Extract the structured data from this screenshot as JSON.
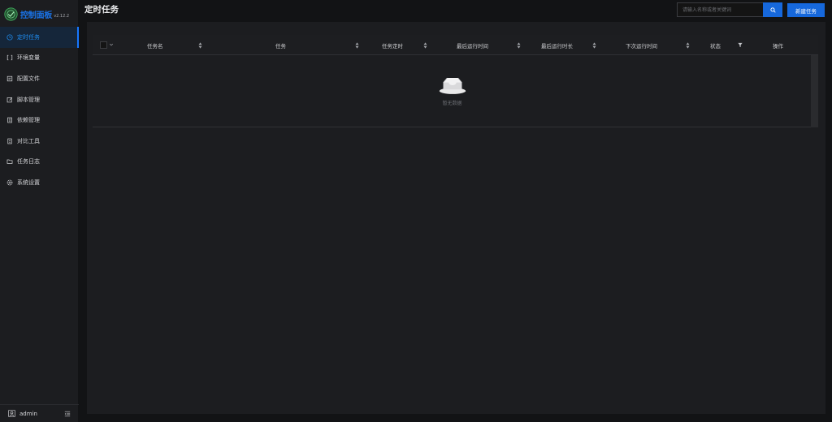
{
  "brand": {
    "title": "控制面板",
    "version": "v2.12.2"
  },
  "sidebar": {
    "items": [
      {
        "label": "定时任务",
        "icon": "clock-icon",
        "active": true
      },
      {
        "label": "环境变量",
        "icon": "variable-icon",
        "active": false
      },
      {
        "label": "配置文件",
        "icon": "form-icon",
        "active": false
      },
      {
        "label": "脚本管理",
        "icon": "edit-icon",
        "active": false
      },
      {
        "label": "依赖管理",
        "icon": "container-icon",
        "active": false
      },
      {
        "label": "对比工具",
        "icon": "diff-icon",
        "active": false
      },
      {
        "label": "任务日志",
        "icon": "folder-icon",
        "active": false
      },
      {
        "label": "系统设置",
        "icon": "setting-icon",
        "active": false
      }
    ],
    "footer": {
      "username": "admin"
    }
  },
  "header": {
    "title": "定时任务",
    "search_placeholder": "请输入名称或者关键词",
    "new_button": "新建任务"
  },
  "table": {
    "columns": [
      {
        "label": "任务名",
        "sortable": true
      },
      {
        "label": "任务",
        "sortable": true
      },
      {
        "label": "任务定时",
        "sortable": true
      },
      {
        "label": "最后运行时间",
        "sortable": true
      },
      {
        "label": "最后运行时长",
        "sortable": true
      },
      {
        "label": "下次运行时间",
        "sortable": true
      },
      {
        "label": "状态",
        "filterable": true
      },
      {
        "label": "操作",
        "sortable": false
      }
    ],
    "rows": [],
    "empty_text": "暂无数据"
  },
  "colors": {
    "accent": "#1668dc",
    "active_text": "#1f8ff5",
    "sidebar_bg": "#1c1d20",
    "page_bg": "#121315"
  }
}
